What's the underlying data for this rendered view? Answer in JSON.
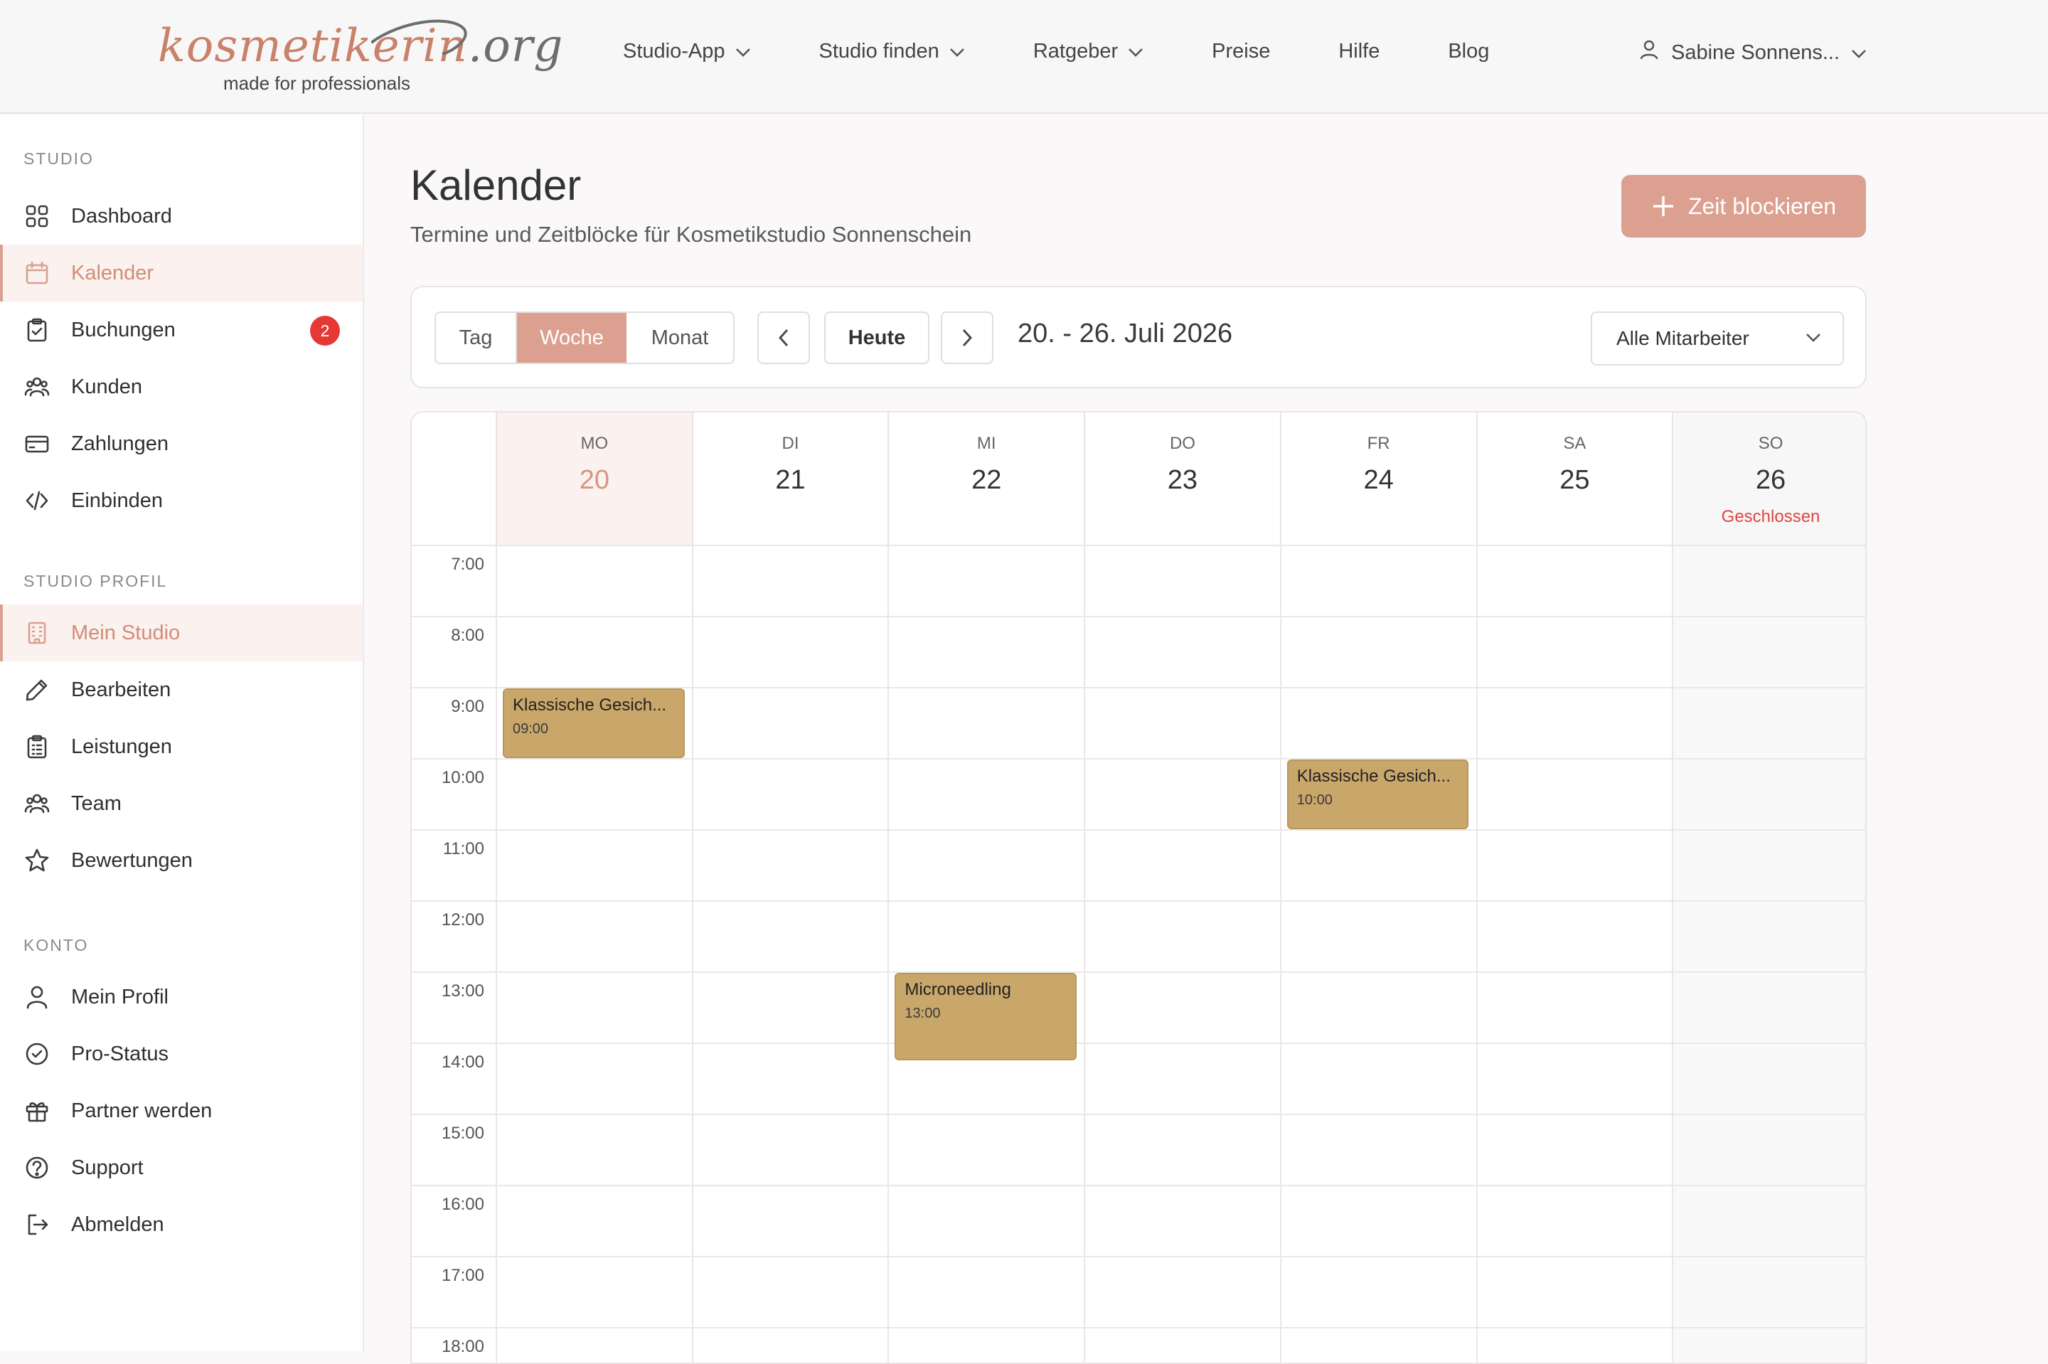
{
  "logo": {
    "word_main": "kosmetikerin",
    "word_tld": ".org",
    "tagline": "made for professionals"
  },
  "nav": {
    "items": [
      {
        "label": "Studio-App",
        "has_menu": true
      },
      {
        "label": "Studio finden",
        "has_menu": true
      },
      {
        "label": "Ratgeber",
        "has_menu": true
      },
      {
        "label": "Preise",
        "has_menu": false
      },
      {
        "label": "Hilfe",
        "has_menu": false
      },
      {
        "label": "Blog",
        "has_menu": false
      }
    ],
    "user": "Sabine Sonnens..."
  },
  "sidebar": {
    "sections": [
      {
        "title": "STUDIO",
        "items": [
          {
            "label": "Dashboard",
            "icon": "grid-icon"
          },
          {
            "label": "Kalender",
            "icon": "calendar-icon",
            "active": true
          },
          {
            "label": "Buchungen",
            "icon": "clipboard-check-icon",
            "badge": "2"
          },
          {
            "label": "Kunden",
            "icon": "users-icon"
          },
          {
            "label": "Zahlungen",
            "icon": "credit-card-icon"
          },
          {
            "label": "Einbinden",
            "icon": "code-icon"
          }
        ]
      },
      {
        "title": "STUDIO PROFIL",
        "items": [
          {
            "label": "Mein Studio",
            "icon": "building-icon",
            "active": true
          },
          {
            "label": "Bearbeiten",
            "icon": "pencil-icon"
          },
          {
            "label": "Leistungen",
            "icon": "clipboard-list-icon"
          },
          {
            "label": "Team",
            "icon": "users-icon"
          },
          {
            "label": "Bewertungen",
            "icon": "star-icon"
          }
        ]
      },
      {
        "title": "KONTO",
        "items": [
          {
            "label": "Mein Profil",
            "icon": "user-icon"
          },
          {
            "label": "Pro-Status",
            "icon": "badge-check-icon"
          },
          {
            "label": "Partner werden",
            "icon": "gift-icon"
          },
          {
            "label": "Support",
            "icon": "help-circle-icon"
          },
          {
            "label": "Abmelden",
            "icon": "logout-icon"
          }
        ]
      }
    ]
  },
  "page": {
    "title": "Kalender",
    "subtitle": "Termine und Zeitblöcke für Kosmetikstudio Sonnenschein",
    "block_button": "Zeit blockieren"
  },
  "toolbar": {
    "views": [
      "Tag",
      "Woche",
      "Monat"
    ],
    "active_view": "Woche",
    "today": "Heute",
    "range": "20. - 26. Juli 2026",
    "staff_filter": "Alle Mitarbeiter"
  },
  "calendar": {
    "days": [
      {
        "name": "MO",
        "date": "20",
        "today": true
      },
      {
        "name": "DI",
        "date": "21"
      },
      {
        "name": "MI",
        "date": "22"
      },
      {
        "name": "DO",
        "date": "23"
      },
      {
        "name": "FR",
        "date": "24"
      },
      {
        "name": "SA",
        "date": "25"
      },
      {
        "name": "SO",
        "date": "26",
        "note": "Geschlossen"
      }
    ],
    "hours": [
      "7:00",
      "8:00",
      "9:00",
      "10:00",
      "11:00",
      "12:00",
      "13:00",
      "14:00",
      "15:00",
      "16:00",
      "17:00",
      "18:00"
    ],
    "events": [
      {
        "day": 0,
        "start": 9.0,
        "end": 10.0,
        "title": "Klassische Gesich...",
        "time": "09:00"
      },
      {
        "day": 4,
        "start": 10.0,
        "end": 11.0,
        "title": "Klassische Gesich...",
        "time": "10:00"
      },
      {
        "day": 2,
        "start": 13.0,
        "end": 14.25,
        "title": "Microneedling",
        "time": "13:00"
      }
    ],
    "colors": {
      "event": "#c9a76a",
      "accent": "#dca091",
      "closed": "#e0443e"
    }
  }
}
